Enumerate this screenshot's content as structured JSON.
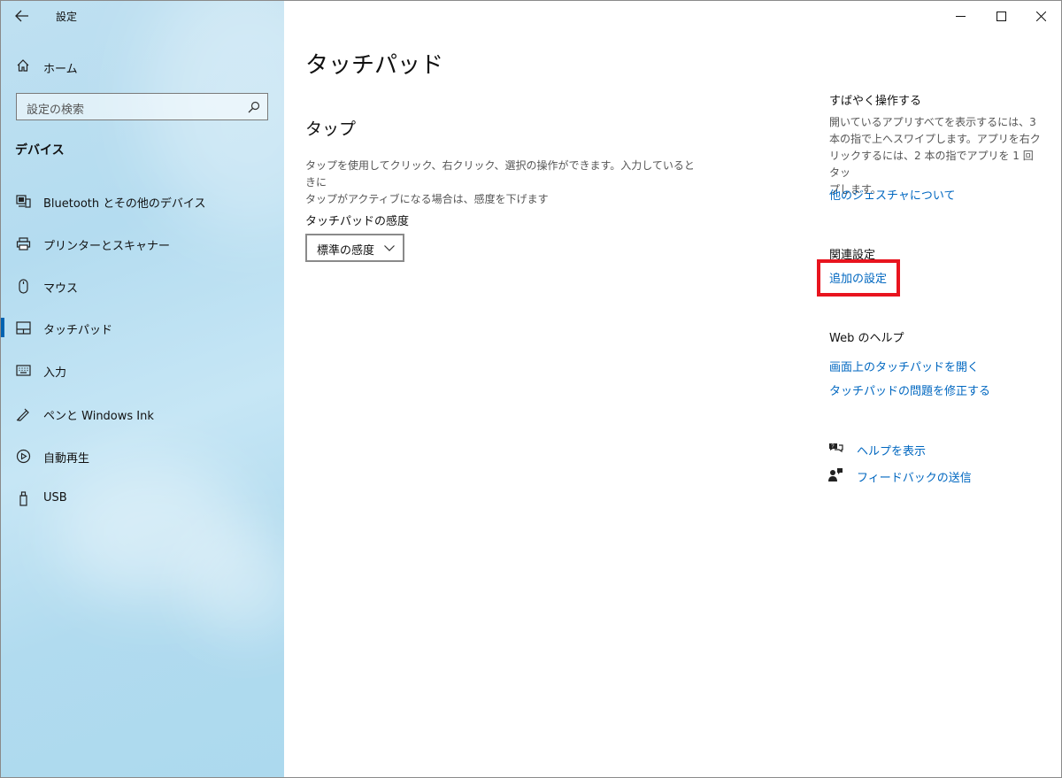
{
  "window": {
    "title": "設定",
    "controls": {
      "minimize": "—",
      "maximize": "☐",
      "close": "✕"
    }
  },
  "sidebar": {
    "home_label": "ホーム",
    "search_placeholder": "設定の検索",
    "section_title": "デバイス",
    "items": [
      {
        "label": "Bluetooth とその他のデバイス",
        "icon": "bluetooth-devices-icon",
        "active": false
      },
      {
        "label": "プリンターとスキャナー",
        "icon": "printer-icon",
        "active": false
      },
      {
        "label": "マウス",
        "icon": "mouse-icon",
        "active": false
      },
      {
        "label": "タッチパッド",
        "icon": "touchpad-icon",
        "active": true
      },
      {
        "label": "入力",
        "icon": "keyboard-icon",
        "active": false
      },
      {
        "label": "ペンと Windows Ink",
        "icon": "pen-icon",
        "active": false
      },
      {
        "label": "自動再生",
        "icon": "autoplay-icon",
        "active": false
      },
      {
        "label": "USB",
        "icon": "usb-icon",
        "active": false
      }
    ]
  },
  "main": {
    "page_title": "タッチパッド",
    "tap": {
      "title": "タップ",
      "description_line1": "タップを使用してクリック、右クリック、選択の操作ができます。入力しているときに",
      "description_line2": "タップがアクティブになる場合は、感度を下げます",
      "sensitivity_label": "タッチパッドの感度",
      "sensitivity_value": "標準の感度"
    }
  },
  "right": {
    "quick": {
      "heading": "すばやく操作する",
      "line1": "開いているアプリすべてを表示するには、3",
      "line2": "本の指で上へスワイプします。アプリを右ク",
      "line3": "リックするには、2 本の指でアプリを 1 回タッ",
      "line4": "プします。",
      "link": "他のジェスチャについて"
    },
    "related": {
      "heading": "関連設定",
      "link": "追加の設定"
    },
    "web_help": {
      "heading": "Web のヘルプ",
      "link1": "画面上のタッチパッドを開く",
      "link2": "タッチパッドの問題を修正する"
    },
    "help_links": {
      "get_help": "ヘルプを表示",
      "feedback": "フィードバックの送信"
    }
  },
  "colors": {
    "accent": "#0063b1",
    "link": "#0067c0",
    "highlight": "#e8141e"
  }
}
